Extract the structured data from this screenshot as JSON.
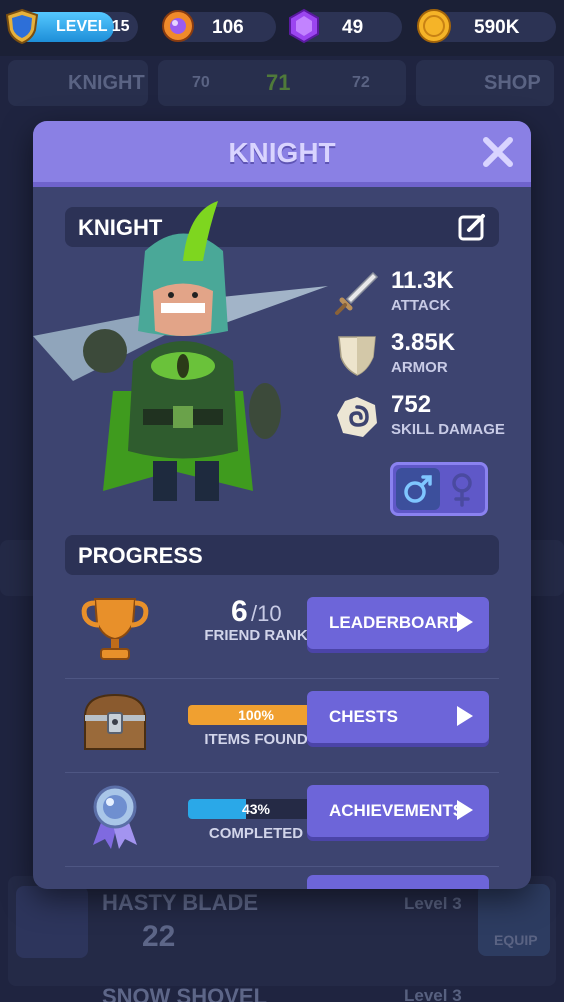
{
  "topbar": {
    "level": "LEVEL 15",
    "orbs": "106",
    "gems": "49",
    "gold": "590K"
  },
  "background": {
    "nav_left": "KNIGHT",
    "nav_right": "SHOP",
    "level_prev": "70",
    "level_current": "71",
    "level_next": "72",
    "item1_name": "HASTY BLADE",
    "item1_level": "Level 3",
    "item1_power": "22",
    "item1_button": "EQUIP",
    "item2_name": "SNOW SHOVEL",
    "item2_level": "Level 3"
  },
  "modal": {
    "title": "KNIGHT",
    "hero_name": "KNIGHT",
    "stats": [
      {
        "value": "11.3K",
        "label": "ATTACK",
        "icon": "sword-icon"
      },
      {
        "value": "3.85K",
        "label": "ARMOR",
        "icon": "shield-icon"
      },
      {
        "value": "752",
        "label": "SKILL DAMAGE",
        "icon": "swirl-icon"
      }
    ],
    "gender_selected": "male",
    "progress_title": "PROGRESS",
    "rows": [
      {
        "big": "6",
        "small": "/10",
        "caption": "FRIEND RANK",
        "button": "LEADERBOARD",
        "icon": "trophy-icon"
      },
      {
        "percent": "100%",
        "fill": 1.0,
        "caption": "ITEMS FOUND",
        "button": "CHESTS",
        "icon": "chest-icon"
      },
      {
        "percent": "43%",
        "fill": 0.43,
        "caption": "COMPLETED",
        "button": "ACHIEVEMENTS",
        "icon": "medal-icon"
      }
    ]
  },
  "colors": {
    "modal_header": "#8a80e4",
    "button": "#6d65d9",
    "orange_bar": "#f0a030",
    "blue_bar": "#2aa8e8"
  }
}
